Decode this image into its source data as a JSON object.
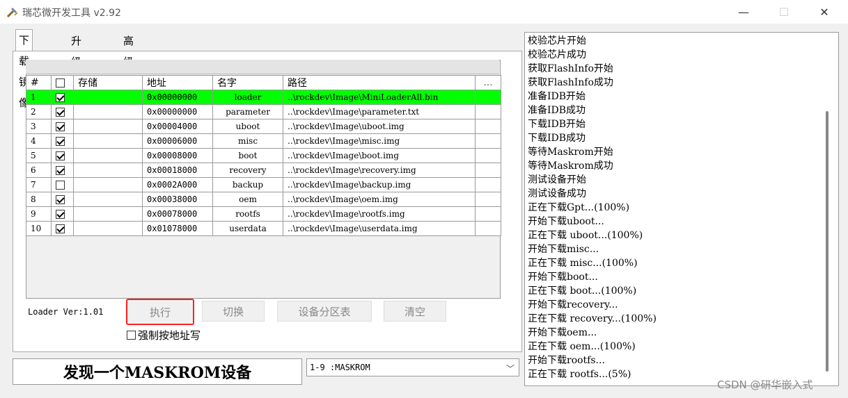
{
  "window": {
    "title": "瑞芯微开发工具 v2.92",
    "min_icon": "—",
    "max_icon": "☐",
    "close_icon": "✕"
  },
  "tabs": [
    "下载镜像",
    "升级固件",
    "高级功能"
  ],
  "table": {
    "headers": [
      "#",
      "",
      "存储",
      "地址",
      "名字",
      "路径",
      "..."
    ],
    "rows": [
      {
        "num": "1",
        "checked": true,
        "storage": "",
        "address": "0x00000000",
        "name": "loader",
        "path": "..\\rockdev\\Image\\MiniLoaderAll.bin",
        "highlight": true
      },
      {
        "num": "2",
        "checked": true,
        "storage": "",
        "address": "0x00000000",
        "name": "parameter",
        "path": "..\\rockdev\\Image\\parameter.txt",
        "highlight": false
      },
      {
        "num": "3",
        "checked": true,
        "storage": "",
        "address": "0x00004000",
        "name": "uboot",
        "path": "..\\rockdev\\Image\\uboot.img",
        "highlight": false
      },
      {
        "num": "4",
        "checked": true,
        "storage": "",
        "address": "0x00006000",
        "name": "misc",
        "path": "..\\rockdev\\Image\\misc.img",
        "highlight": false
      },
      {
        "num": "5",
        "checked": true,
        "storage": "",
        "address": "0x00008000",
        "name": "boot",
        "path": "..\\rockdev\\Image\\boot.img",
        "highlight": false
      },
      {
        "num": "6",
        "checked": true,
        "storage": "",
        "address": "0x00018000",
        "name": "recovery",
        "path": "..\\rockdev\\Image\\recovery.img",
        "highlight": false
      },
      {
        "num": "7",
        "checked": false,
        "storage": "",
        "address": "0x0002A000",
        "name": "backup",
        "path": "..\\rockdev\\Image\\backup.img",
        "highlight": false
      },
      {
        "num": "8",
        "checked": true,
        "storage": "",
        "address": "0x00038000",
        "name": "oem",
        "path": "..\\rockdev\\Image\\oem.img",
        "highlight": false
      },
      {
        "num": "9",
        "checked": true,
        "storage": "",
        "address": "0x00078000",
        "name": "rootfs",
        "path": "..\\rockdev\\Image\\rootfs.img",
        "highlight": false
      },
      {
        "num": "10",
        "checked": true,
        "storage": "",
        "address": "0x01078000",
        "name": "userdata",
        "path": "..\\rockdev\\Image\\userdata.img",
        "highlight": false
      }
    ]
  },
  "loader_version": "Loader Ver:1.01",
  "buttons": {
    "execute": "执行",
    "switch": "切换",
    "partition_table": "设备分区表",
    "clear": "清空"
  },
  "force_address_write": "强制按地址写",
  "status_text": "发现一个MASKROM设备",
  "device_select": "1-9 :MASKROM",
  "log_lines": [
    "校验芯片开始",
    "校验芯片成功",
    "获取FlashInfo开始",
    "获取FlashInfo成功",
    "准备IDB开始",
    "准备IDB成功",
    "下载IDB开始",
    "下载IDB成功",
    "等待Maskrom开始",
    "等待Maskrom成功",
    "测试设备开始",
    "测试设备成功",
    "正在下载Gpt...(100%)",
    "开始下载uboot...",
    "正在下载 uboot...(100%)",
    "开始下载misc...",
    "正在下载 misc...(100%)",
    "开始下载boot...",
    "正在下载 boot...(100%)",
    "开始下载recovery...",
    "正在下载 recovery...(100%)",
    "开始下载oem...",
    "正在下载 oem...(100%)",
    "开始下载rootfs...",
    "正在下载 rootfs...(5%)"
  ],
  "watermark": "CSDN @研华嵌入式"
}
